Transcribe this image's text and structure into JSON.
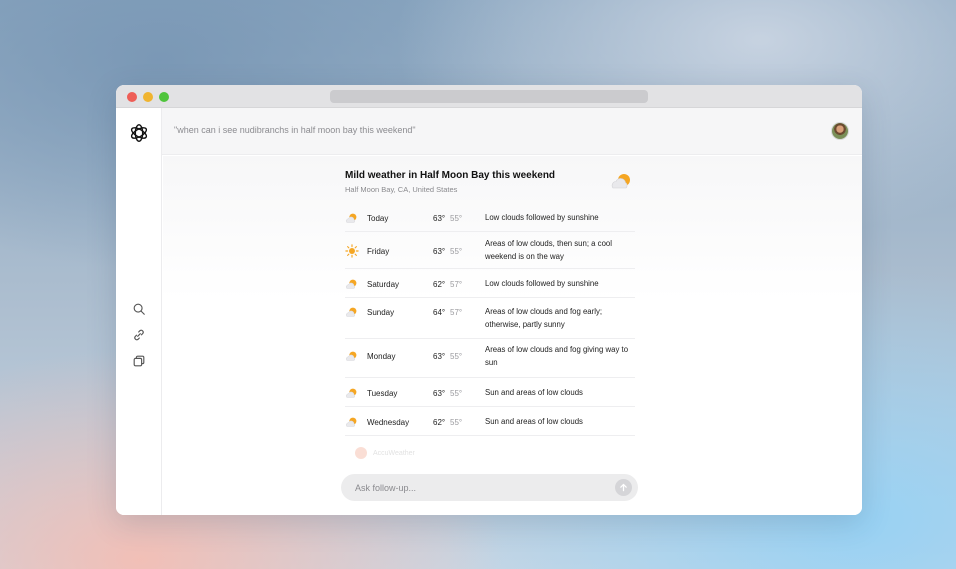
{
  "topbar": {
    "query": "\"when can i see nudibranchs in half moon bay this weekend\""
  },
  "icons": {
    "logo": "openai-logo-icon",
    "sidebar": [
      "search-icon",
      "link-icon",
      "copy-icon"
    ],
    "header": "partly-cloudy-icon",
    "send": "arrow-up-icon"
  },
  "weather": {
    "title": "Mild weather in Half Moon Bay this weekend",
    "location": "Half Moon Bay, CA, United States",
    "days": [
      {
        "day": "Today",
        "high": "63°",
        "low": "55°",
        "desc": "Low clouds followed by sunshine",
        "icon": "partly-cloudy-icon"
      },
      {
        "day": "Friday",
        "high": "63°",
        "low": "55°",
        "desc": "Areas of low clouds, then sun; a cool weekend is on the way",
        "icon": "sun-icon"
      },
      {
        "day": "Saturday",
        "high": "62°",
        "low": "57°",
        "desc": "Low clouds followed by sunshine",
        "icon": "partly-cloudy-icon"
      },
      {
        "day": "Sunday",
        "high": "64°",
        "low": "57°",
        "desc": "Areas of low clouds and fog early; otherwise, partly sunny",
        "icon": "partly-cloudy-icon"
      },
      {
        "day": "Monday",
        "high": "63°",
        "low": "55°",
        "desc": "Areas of low clouds and fog giving way to sun",
        "icon": "partly-cloudy-icon"
      },
      {
        "day": "Tuesday",
        "high": "63°",
        "low": "55°",
        "desc": "Sun and areas of low clouds",
        "icon": "partly-cloudy-icon"
      },
      {
        "day": "Wednesday",
        "high": "62°",
        "low": "55°",
        "desc": "Sun and areas of low clouds",
        "icon": "partly-cloudy-icon"
      }
    ],
    "source": "AccuWeather"
  },
  "followup": {
    "placeholder": "Ask follow-up..."
  },
  "colors": {
    "close": "#ee5e57",
    "minimize": "#f0b430",
    "maximize": "#4fc43c",
    "sun": "#f5a623"
  }
}
